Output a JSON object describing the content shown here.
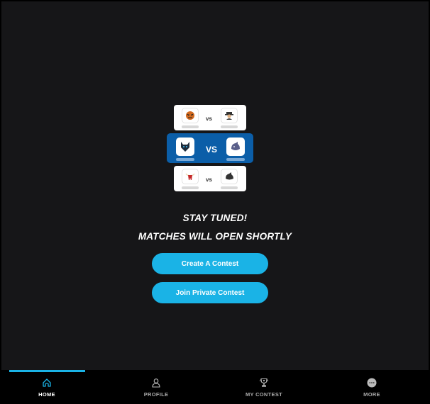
{
  "illustration": {
    "matches": [
      {
        "home": "tiger",
        "away": "spy",
        "vs": "vs",
        "highlighted": false
      },
      {
        "home": "wolf",
        "away": "rhino-blue",
        "vs": "VS",
        "highlighted": true
      },
      {
        "home": "bull",
        "away": "rhino",
        "vs": "vs",
        "highlighted": false
      }
    ]
  },
  "message": {
    "title": "STAY TUNED!",
    "subtitle": "MATCHES WILL OPEN SHORTLY"
  },
  "actions": {
    "create_contest": "Create A Contest",
    "join_private_contest": "Join Private Contest"
  },
  "colors": {
    "accent": "#1ab3e6",
    "highlight_card": "#0b5ea8",
    "background": "#161618",
    "nav_background": "#000000"
  },
  "nav": {
    "active": "home",
    "items": [
      {
        "id": "home",
        "label": "HOME",
        "icon": "home-icon"
      },
      {
        "id": "profile",
        "label": "PROFILE",
        "icon": "user-icon"
      },
      {
        "id": "my_contest",
        "label": "MY CONTEST",
        "icon": "trophy-icon"
      },
      {
        "id": "more",
        "label": "MORE",
        "icon": "more-icon"
      }
    ]
  }
}
